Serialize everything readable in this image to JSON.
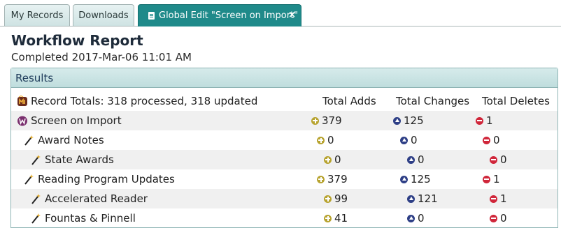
{
  "tabs": [
    {
      "label": "My Records"
    },
    {
      "label": "Downloads"
    },
    {
      "label": "Global Edit \"Screen on Import\"",
      "close": "×"
    }
  ],
  "report": {
    "title": "Workflow Report",
    "subtitle": "Completed 2017-Mar-06 11:01 AM"
  },
  "panel": {
    "header": "Results",
    "totals_label": "Record Totals: 318 processed, 318 updated",
    "columns": [
      "Total Adds",
      "Total Changes",
      "Total Deletes"
    ],
    "rows": [
      {
        "label": "Screen on Import",
        "adds": "379",
        "changes": "125",
        "deletes": "1"
      },
      {
        "label": "Award Notes",
        "adds": "0",
        "changes": "0",
        "deletes": "0"
      },
      {
        "label": "State Awards",
        "adds": "0",
        "changes": "0",
        "deletes": "0"
      },
      {
        "label": "Reading Program Updates",
        "adds": "379",
        "changes": "125",
        "deletes": "1"
      },
      {
        "label": "Accelerated Reader",
        "adds": "99",
        "changes": "121",
        "deletes": "1"
      },
      {
        "label": "Fountas & Pinnell",
        "adds": "41",
        "changes": "0",
        "deletes": "0"
      }
    ]
  },
  "icons": {
    "doc": "document-icon",
    "logo": "mandarin-logo-icon",
    "wand": "magic-wand-icon",
    "add": "add-circle-icon",
    "change": "change-triangle-icon",
    "delete": "delete-circle-icon"
  },
  "colors": {
    "active_tab": "#1f8a8a",
    "panel_header": "#c9e3e3",
    "add": "#b7a32f",
    "change": "#2e3f86",
    "delete": "#d0263a"
  }
}
